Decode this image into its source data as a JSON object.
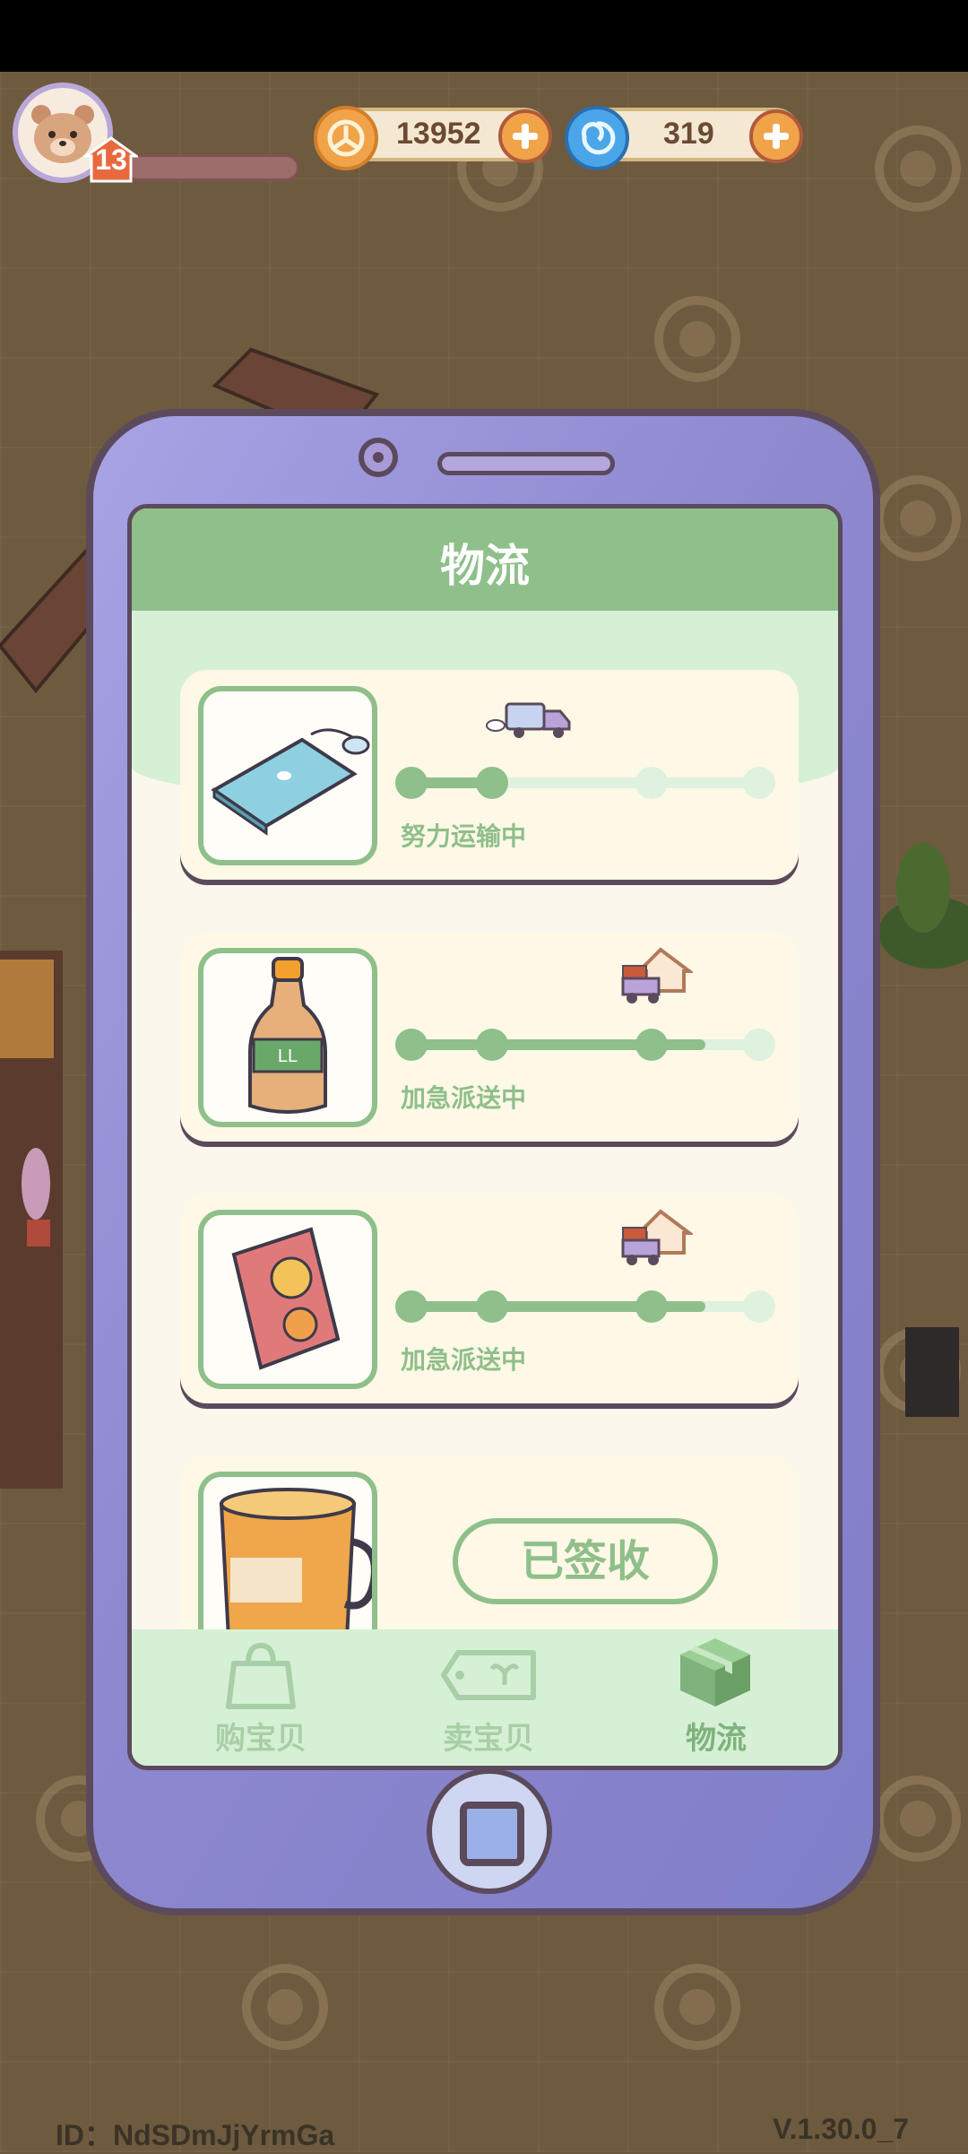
{
  "hud": {
    "level": "13",
    "coins": "13952",
    "gems": "319"
  },
  "screen": {
    "title": "物流"
  },
  "shipments": [
    {
      "item": "keyboard-mouse",
      "status": "努力运输中",
      "progress_steps_done": 2,
      "total_steps": 4
    },
    {
      "item": "soda-bottle",
      "status": "加急派送中",
      "progress_steps_done": 3,
      "total_steps": 4
    },
    {
      "item": "snack-bag",
      "status": "加急派送中",
      "progress_steps_done": 3,
      "total_steps": 4
    },
    {
      "item": "mug",
      "status": "",
      "button_label": "已签收"
    }
  ],
  "tabs": [
    {
      "label": "购宝贝",
      "icon": "shopping-bag-icon",
      "active": false
    },
    {
      "label": "卖宝贝",
      "icon": "price-tag-icon",
      "active": false
    },
    {
      "label": "物流",
      "icon": "package-box-icon",
      "active": true
    }
  ],
  "footer": {
    "id_text": "ID：NdSDmJjYrmGa",
    "version": "V.1.30.0_7"
  },
  "colors": {
    "accent_green": "#8fbf8a",
    "phone_purple": "#8f8ad0",
    "coin_gold": "#f1a34a",
    "gem_blue": "#4aa6e8"
  }
}
